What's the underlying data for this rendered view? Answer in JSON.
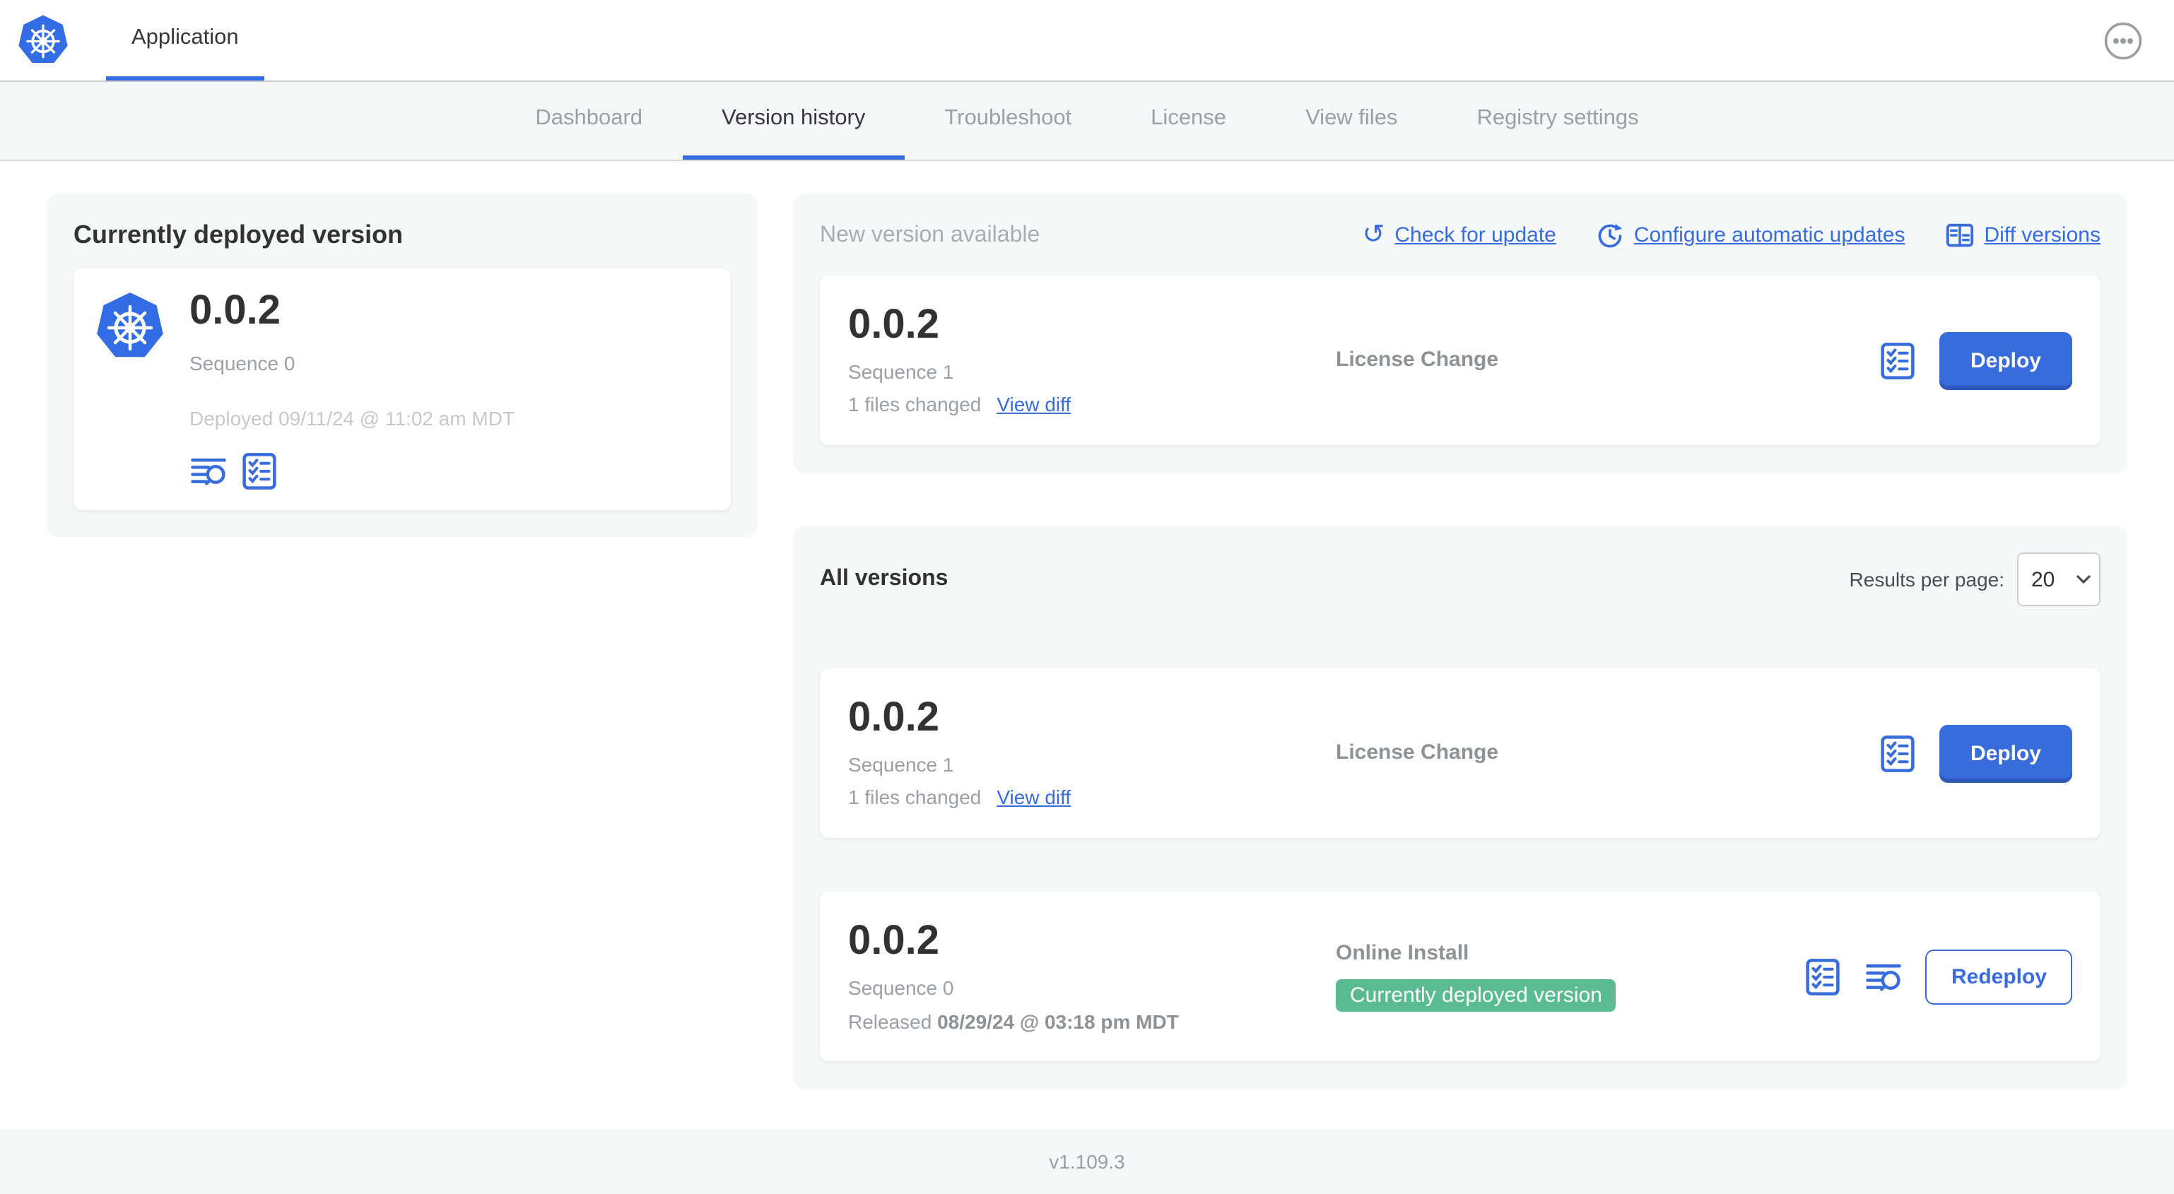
{
  "colors": {
    "accent": "#386bdc",
    "k8sBlue": "#326de6",
    "green": "#5abb91",
    "panel": "#f5f8f9",
    "subnav": "#f4f7f8",
    "dark": "#35373a",
    "gray": "#9aa0a6",
    "light": "#c5c9cd",
    "mutedTitle": "#a9adb2"
  },
  "header": {
    "app_tab_label": "Application",
    "logo_icon": "kubernetes-wheel-icon",
    "more_icon": "ellipsis-icon"
  },
  "nav": {
    "tabs": [
      {
        "label": "Dashboard",
        "active": false
      },
      {
        "label": "Version history",
        "active": true
      },
      {
        "label": "Troubleshoot",
        "active": false
      },
      {
        "label": "License",
        "active": false
      },
      {
        "label": "View files",
        "active": false
      },
      {
        "label": "Registry settings",
        "active": false
      }
    ]
  },
  "current_version": {
    "title": "Currently deployed version",
    "version": "0.0.2",
    "sequence": "Sequence 0",
    "deployed": "Deployed 09/11/24 @ 11:02 am MDT",
    "icons": [
      "logs-icon",
      "checklist-icon"
    ]
  },
  "new_version": {
    "title": "New version available",
    "actions": {
      "check_for_update": "Check for update",
      "configure_automatic_updates": "Configure automatic updates",
      "diff_versions": "Diff versions"
    },
    "card": {
      "version": "0.0.2",
      "sequence": "Sequence 1",
      "files_changed": "1 files changed",
      "view_diff": "View diff",
      "source": "License Change",
      "deploy_label": "Deploy"
    }
  },
  "all_versions": {
    "title": "All versions",
    "results_per_page_label": "Results per page:",
    "results_per_page_value": "20",
    "rows": [
      {
        "version": "0.0.2",
        "sequence": "Sequence 1",
        "files_changed": "1 files changed",
        "view_diff": "View diff",
        "source": "License Change",
        "action_label": "Deploy"
      },
      {
        "version": "0.0.2",
        "sequence": "Sequence 0",
        "released_prefix": "Released",
        "released_date": "08/29/24 @ 03:18 pm MDT",
        "source": "Online Install",
        "badge": "Currently deployed version",
        "action_label": "Redeploy"
      }
    ]
  },
  "footer": {
    "console_version": "v1.109.3"
  }
}
